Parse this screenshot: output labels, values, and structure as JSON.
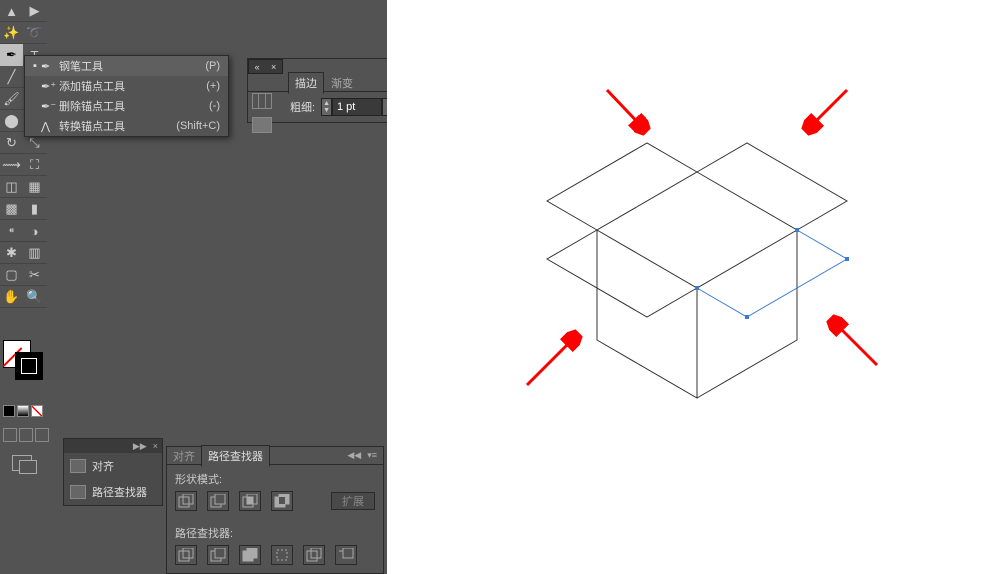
{
  "flyout": {
    "items": [
      {
        "label": "钢笔工具",
        "shortcut": "(P)",
        "selected": true
      },
      {
        "label": "添加锚点工具",
        "shortcut": "(+)",
        "selected": false
      },
      {
        "label": "删除锚点工具",
        "shortcut": "(-)",
        "selected": false
      },
      {
        "label": "转换锚点工具",
        "shortcut": "(Shift+C)",
        "selected": false
      }
    ]
  },
  "stroke_panel": {
    "tabs": {
      "stroke": "描边",
      "gradient": "渐变"
    },
    "weight_label": "粗细:",
    "weight_value": "1 pt"
  },
  "mini_tabgroup": {
    "rows": [
      {
        "label": "对齐"
      },
      {
        "label": "路径查找器"
      }
    ]
  },
  "pathfinder": {
    "tabs": {
      "align": "对齐",
      "pathfinder": "路径查找器"
    },
    "section_shape": "形状模式:",
    "section_pf": "路径查找器:",
    "expand": "扩展"
  }
}
